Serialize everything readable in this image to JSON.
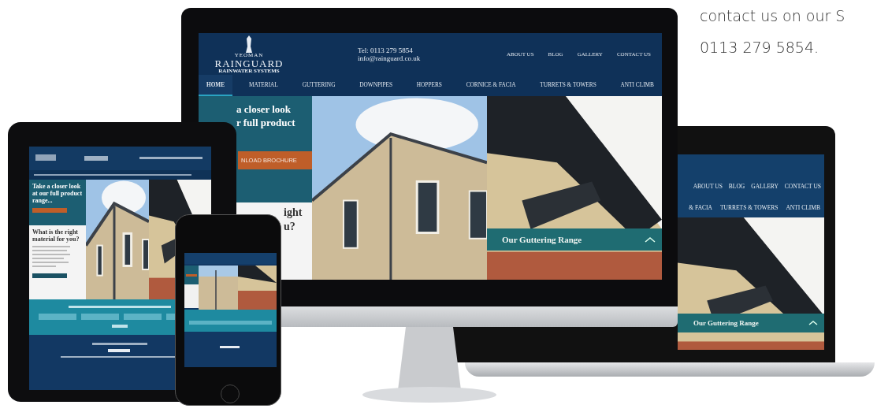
{
  "page_text": [
    "contact us on our S",
    "0113 279 5854."
  ],
  "desktop": {
    "logo": {
      "top": "YEOMAN",
      "name": "RAINGUARD",
      "tagline": "RAINWATER SYSTEMS"
    },
    "phone": "Tel: 0113 279 5854",
    "email": "info@rainguard.co.uk",
    "top_nav": [
      "ABOUT US",
      "BLOG",
      "GALLERY",
      "CONTACT US"
    ],
    "main_nav": [
      {
        "label": "HOME",
        "selected": true
      },
      {
        "label": "MATERIAL",
        "selected": false
      },
      {
        "label": "GUTTERING",
        "selected": false
      },
      {
        "label": "DOWNPIPES",
        "selected": false
      },
      {
        "label": "HOPPERS",
        "selected": false
      },
      {
        "label": "CORNICE & FACIA",
        "selected": false
      },
      {
        "label": "TURRETS & TOWERS",
        "selected": false
      },
      {
        "label": "ANTI CLIMB",
        "selected": false
      }
    ],
    "hero": {
      "heading_lines": [
        "a closer look",
        "r full product"
      ],
      "button": "NLOAD BROCHURE",
      "subheading_lines": [
        "ight",
        "u?"
      ]
    },
    "banner": "Our Guttering Range"
  },
  "laptop": {
    "top_nav": [
      "ABOUT US",
      "BLOG",
      "GALLERY",
      "CONTACT US"
    ],
    "main_nav": [
      "& FACIA",
      "TURRETS & TOWERS",
      "ANTI CLIMB"
    ],
    "banner": "Our Guttering Range"
  },
  "tablet": {
    "heading": "Take a closer look at our full product range...",
    "subheading": "What is the right material for you?"
  }
}
